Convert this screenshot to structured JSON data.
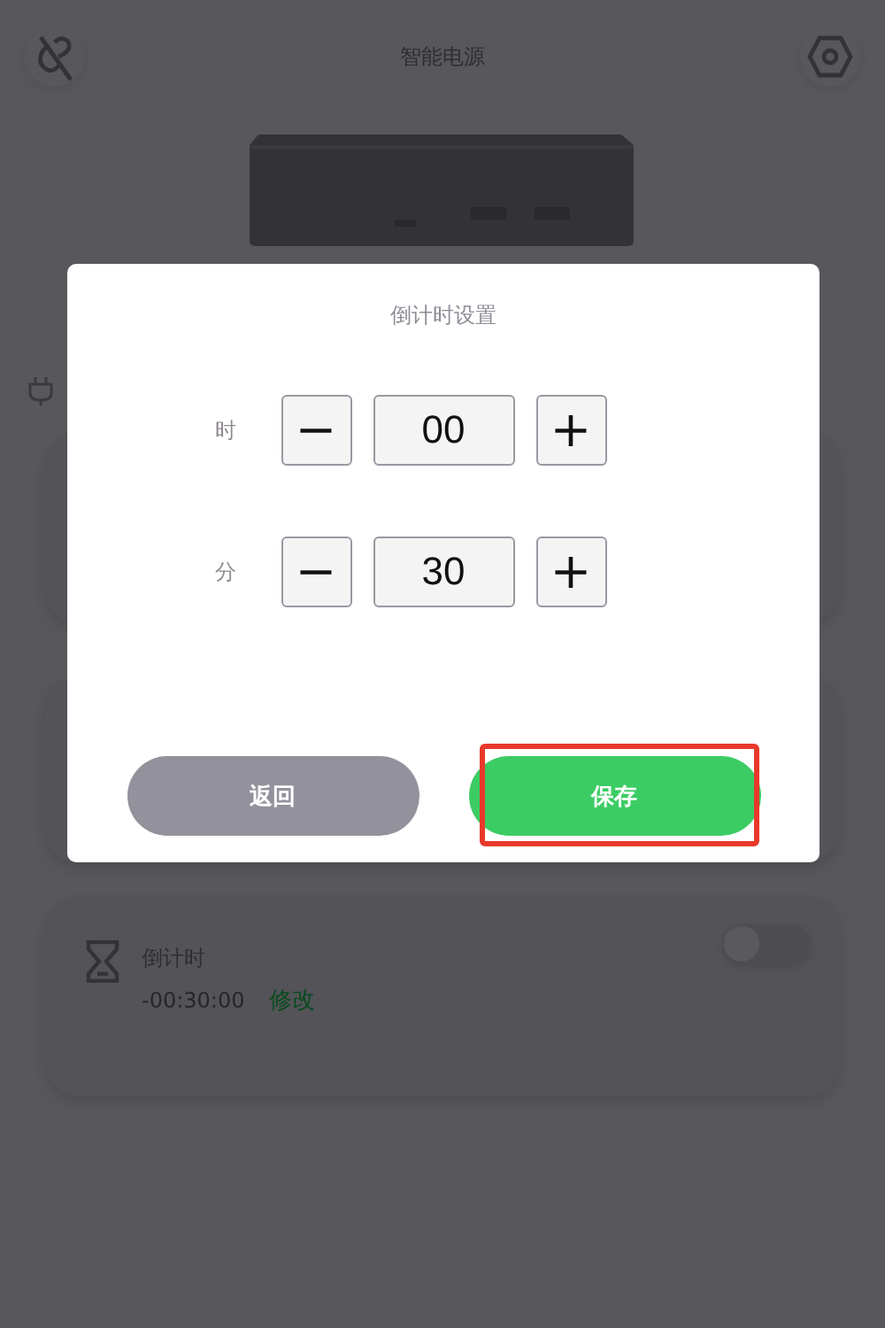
{
  "header": {
    "title": "智能电源"
  },
  "countdown_card": {
    "title": "倒计时",
    "remaining": "-00:30:00",
    "edit_link": "修改",
    "on": false
  },
  "dialog": {
    "title": "倒计时设置",
    "fields": [
      {
        "label": "时",
        "decrement": "−",
        "value": "00",
        "increment": "+"
      },
      {
        "label": "分",
        "decrement": "−",
        "value": "30",
        "increment": "+"
      }
    ],
    "buttons": [
      {
        "label": "返回",
        "kind": "secondary",
        "highlighted": false
      },
      {
        "label": "保存",
        "kind": "primary",
        "highlighted": true
      }
    ]
  }
}
